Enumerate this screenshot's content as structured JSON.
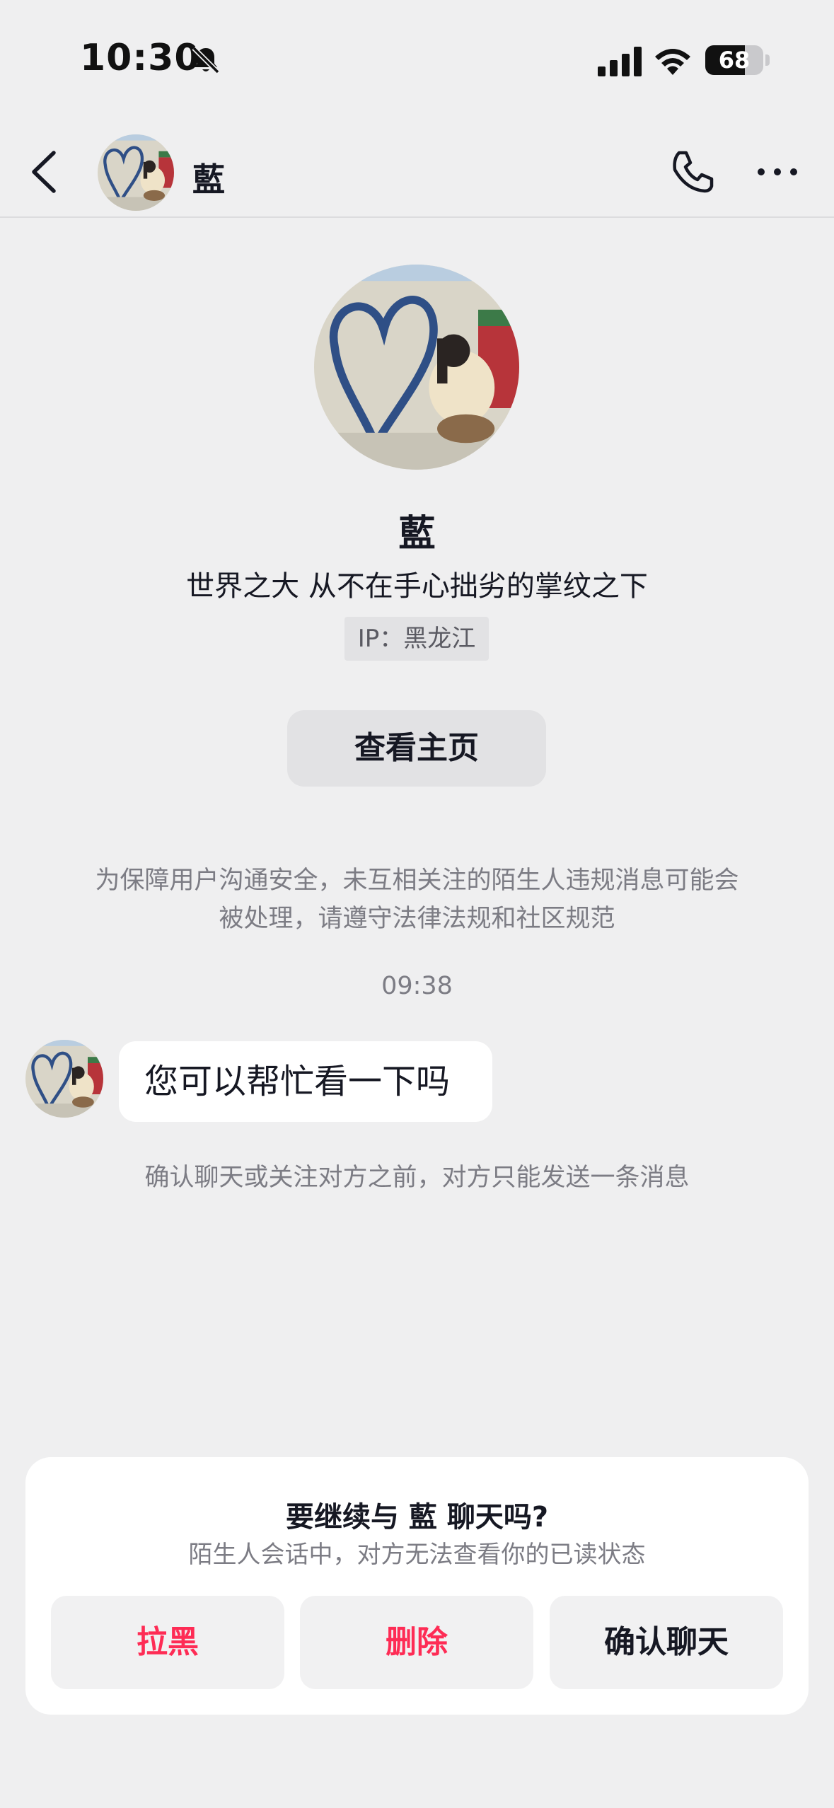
{
  "status_bar": {
    "time": "10:30",
    "battery_level": "68",
    "battery_fraction": 0.68,
    "icons": [
      "bell-slash-icon",
      "cellular-signal-icon",
      "wifi-icon",
      "battery-icon"
    ]
  },
  "header": {
    "name": "藍",
    "icons": [
      "chevron-left-icon",
      "phone-icon",
      "more-dots-icon"
    ]
  },
  "profile": {
    "name": "藍",
    "bio": "世界之大 从不在手心拙劣的掌纹之下",
    "ip": "IP：黑龙江",
    "view_home_label": "查看主页"
  },
  "safety_notice": "为保障用户沟通安全，未互相关注的陌生人违规消息可能会被处理，请遵守法律法规和社区规范",
  "chat": {
    "timestamp": "09:38",
    "message": "您可以帮忙看一下吗",
    "limit_note": "确认聊天或关注对方之前，对方只能发送一条消息"
  },
  "confirm_card": {
    "title": "要继续与 藍 聊天吗?",
    "subtitle": "陌生人会话中，对方无法查看你的已读状态",
    "buttons": {
      "block": "拉黑",
      "delete": "删除",
      "confirm": "确认聊天"
    }
  },
  "colors": {
    "background": "#efeff0",
    "danger": "#fe2c55",
    "text": "#161823",
    "muted": "#7c7c84"
  }
}
